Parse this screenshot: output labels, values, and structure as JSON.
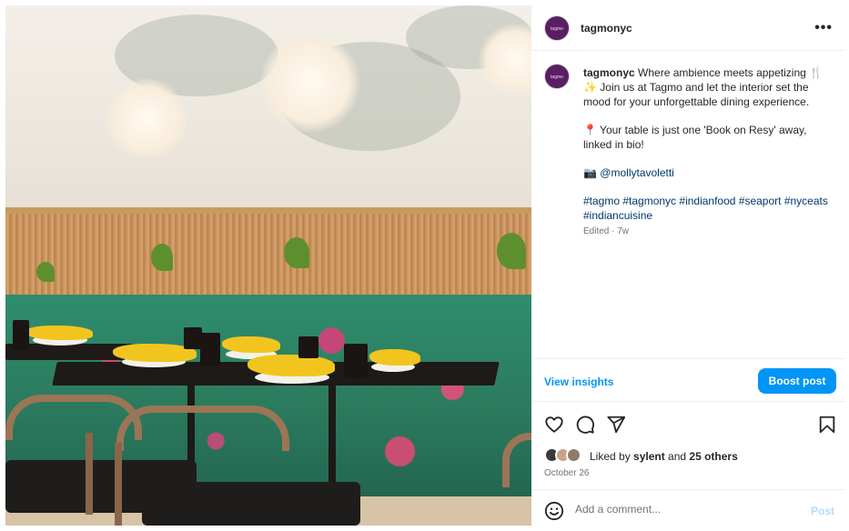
{
  "post": {
    "username": "tagmonyc",
    "avatar_text": "tagmo",
    "more_label": "•••"
  },
  "caption": {
    "username": "tagmonyc",
    "line1": "Where ambience meets appetizing 🍴✨ Join us at Tagmo and let the interior set the mood for your unforgettable dining experience.",
    "line2": "📍 Your table is just one 'Book on Resy' away, linked in bio!",
    "camera_emoji": "📷",
    "mention": "@mollytavoletti",
    "hashtags": "#tagmo #tagmonyc #indianfood #seaport #nyceats #indiancuisine",
    "edited": "Edited · 7w"
  },
  "insights": {
    "view_label": "View insights",
    "boost_label": "Boost post"
  },
  "actions": {
    "like_icon": "heart-icon",
    "comment_icon": "comment-icon",
    "share_icon": "share-icon",
    "save_icon": "bookmark-icon"
  },
  "likes": {
    "prefix": "Liked by ",
    "user": "sylent",
    "middle": " and ",
    "others": "25 others"
  },
  "date": "October 26",
  "comment": {
    "placeholder": "Add a comment...",
    "post_label": "Post"
  },
  "colors": {
    "accent": "#0095f6",
    "post_disabled": "#b3dbff",
    "avatar_bg": "#5a1f63"
  }
}
